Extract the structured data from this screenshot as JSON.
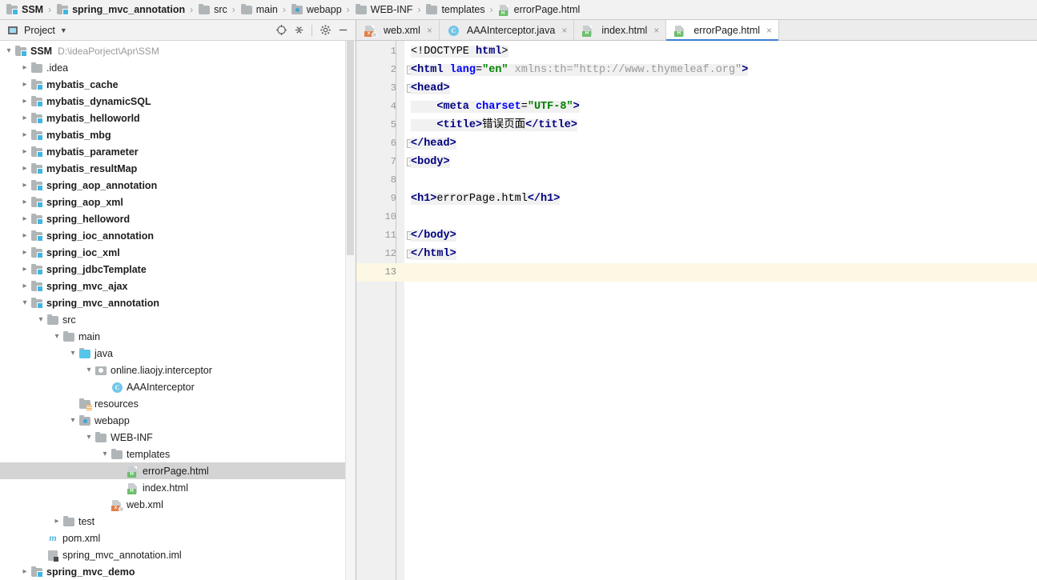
{
  "breadcrumb": {
    "items": [
      {
        "label": "SSM",
        "icon": "module-icon",
        "bold": true
      },
      {
        "label": "spring_mvc_annotation",
        "icon": "module-icon",
        "bold": true
      },
      {
        "label": "src",
        "icon": "folder-icon",
        "bold": false
      },
      {
        "label": "main",
        "icon": "folder-icon",
        "bold": false
      },
      {
        "label": "webapp",
        "icon": "web-folder-icon",
        "bold": false
      },
      {
        "label": "WEB-INF",
        "icon": "folder-icon",
        "bold": false
      },
      {
        "label": "templates",
        "icon": "folder-icon",
        "bold": false
      },
      {
        "label": "errorPage.html",
        "icon": "html-file-icon",
        "bold": false
      }
    ],
    "separator": "›"
  },
  "tool_window": {
    "title": "Project",
    "dropdown_caret": "▼",
    "actions": [
      {
        "name": "select-opened-file-icon",
        "glyph": "⊕"
      },
      {
        "name": "collapse-all-icon",
        "glyph": "⩒"
      },
      {
        "name": "settings-gear-icon",
        "glyph": "⚙"
      },
      {
        "name": "hide-icon",
        "glyph": "—"
      }
    ]
  },
  "tree": {
    "rows": [
      {
        "label": "SSM",
        "hint": "D:\\ideaPorject\\Apr\\SSM",
        "indent": 0,
        "arrow": "expanded",
        "icon": "module-icon",
        "bold": true,
        "selected": false
      },
      {
        "label": ".idea",
        "hint": "",
        "indent": 1,
        "arrow": "collapsed",
        "icon": "folder-icon",
        "bold": false,
        "selected": false
      },
      {
        "label": "mybatis_cache",
        "hint": "",
        "indent": 1,
        "arrow": "collapsed",
        "icon": "module-icon",
        "bold": true,
        "selected": false
      },
      {
        "label": "mybatis_dynamicSQL",
        "hint": "",
        "indent": 1,
        "arrow": "collapsed",
        "icon": "module-icon",
        "bold": true,
        "selected": false
      },
      {
        "label": "mybatis_helloworld",
        "hint": "",
        "indent": 1,
        "arrow": "collapsed",
        "icon": "module-icon",
        "bold": true,
        "selected": false
      },
      {
        "label": "mybatis_mbg",
        "hint": "",
        "indent": 1,
        "arrow": "collapsed",
        "icon": "module-icon",
        "bold": true,
        "selected": false
      },
      {
        "label": "mybatis_parameter",
        "hint": "",
        "indent": 1,
        "arrow": "collapsed",
        "icon": "module-icon",
        "bold": true,
        "selected": false
      },
      {
        "label": "mybatis_resultMap",
        "hint": "",
        "indent": 1,
        "arrow": "collapsed",
        "icon": "module-icon",
        "bold": true,
        "selected": false
      },
      {
        "label": "spring_aop_annotation",
        "hint": "",
        "indent": 1,
        "arrow": "collapsed",
        "icon": "module-icon",
        "bold": true,
        "selected": false
      },
      {
        "label": "spring_aop_xml",
        "hint": "",
        "indent": 1,
        "arrow": "collapsed",
        "icon": "module-icon",
        "bold": true,
        "selected": false
      },
      {
        "label": "spring_helloword",
        "hint": "",
        "indent": 1,
        "arrow": "collapsed",
        "icon": "module-icon",
        "bold": true,
        "selected": false
      },
      {
        "label": "spring_ioc_annotation",
        "hint": "",
        "indent": 1,
        "arrow": "collapsed",
        "icon": "module-icon",
        "bold": true,
        "selected": false
      },
      {
        "label": "spring_ioc_xml",
        "hint": "",
        "indent": 1,
        "arrow": "collapsed",
        "icon": "module-icon",
        "bold": true,
        "selected": false
      },
      {
        "label": "spring_jdbcTemplate",
        "hint": "",
        "indent": 1,
        "arrow": "collapsed",
        "icon": "module-icon",
        "bold": true,
        "selected": false
      },
      {
        "label": "spring_mvc_ajax",
        "hint": "",
        "indent": 1,
        "arrow": "collapsed",
        "icon": "module-icon",
        "bold": true,
        "selected": false
      },
      {
        "label": "spring_mvc_annotation",
        "hint": "",
        "indent": 1,
        "arrow": "expanded",
        "icon": "module-icon",
        "bold": true,
        "selected": false
      },
      {
        "label": "src",
        "hint": "",
        "indent": 2,
        "arrow": "expanded",
        "icon": "folder-icon",
        "bold": false,
        "selected": false
      },
      {
        "label": "main",
        "hint": "",
        "indent": 3,
        "arrow": "expanded",
        "icon": "folder-icon",
        "bold": false,
        "selected": false
      },
      {
        "label": "java",
        "hint": "",
        "indent": 4,
        "arrow": "expanded",
        "icon": "source-folder-icon",
        "bold": false,
        "selected": false
      },
      {
        "label": "online.liaojy.interceptor",
        "hint": "",
        "indent": 5,
        "arrow": "expanded",
        "icon": "package-icon",
        "bold": false,
        "selected": false
      },
      {
        "label": "AAAInterceptor",
        "hint": "",
        "indent": 6,
        "arrow": "none",
        "icon": "java-class-icon",
        "bold": false,
        "selected": false
      },
      {
        "label": "resources",
        "hint": "",
        "indent": 4,
        "arrow": "none",
        "icon": "resources-folder-icon",
        "bold": false,
        "selected": false
      },
      {
        "label": "webapp",
        "hint": "",
        "indent": 4,
        "arrow": "expanded",
        "icon": "web-folder-icon",
        "bold": false,
        "selected": false
      },
      {
        "label": "WEB-INF",
        "hint": "",
        "indent": 5,
        "arrow": "expanded",
        "icon": "folder-icon",
        "bold": false,
        "selected": false
      },
      {
        "label": "templates",
        "hint": "",
        "indent": 6,
        "arrow": "expanded",
        "icon": "folder-icon",
        "bold": false,
        "selected": false
      },
      {
        "label": "errorPage.html",
        "hint": "",
        "indent": 7,
        "arrow": "none",
        "icon": "html-file-icon",
        "bold": false,
        "selected": true
      },
      {
        "label": "index.html",
        "hint": "",
        "indent": 7,
        "arrow": "none",
        "icon": "html-file-icon",
        "bold": false,
        "selected": false
      },
      {
        "label": "web.xml",
        "hint": "",
        "indent": 6,
        "arrow": "none",
        "icon": "web-xml-file-icon",
        "bold": false,
        "selected": false
      },
      {
        "label": "test",
        "hint": "",
        "indent": 3,
        "arrow": "collapsed",
        "icon": "folder-icon",
        "bold": false,
        "selected": false
      },
      {
        "label": "pom.xml",
        "hint": "",
        "indent": 2,
        "arrow": "none",
        "icon": "maven-pom-icon",
        "bold": false,
        "selected": false
      },
      {
        "label": "spring_mvc_annotation.iml",
        "hint": "",
        "indent": 2,
        "arrow": "none",
        "icon": "iml-file-icon",
        "bold": false,
        "selected": false
      },
      {
        "label": "spring_mvc_demo",
        "hint": "",
        "indent": 1,
        "arrow": "collapsed",
        "icon": "module-icon",
        "bold": true,
        "selected": false
      }
    ]
  },
  "editor_tabs": [
    {
      "label": "web.xml",
      "icon": "web-xml-file-icon",
      "active": false,
      "close": "×"
    },
    {
      "label": "AAAInterceptor.java",
      "icon": "java-class-icon",
      "active": false,
      "close": "×"
    },
    {
      "label": "index.html",
      "icon": "html-file-icon",
      "active": false,
      "close": "×"
    },
    {
      "label": "errorPage.html",
      "icon": "html-file-icon",
      "active": true,
      "close": "×"
    }
  ],
  "editor": {
    "current_line": 13,
    "line_numbers": [
      "1",
      "2",
      "3",
      "4",
      "5",
      "6",
      "7",
      "8",
      "9",
      "10",
      "11",
      "12",
      "13"
    ],
    "folds": {
      "2": true,
      "3": true,
      "6": true,
      "7": true,
      "11": true,
      "12": true
    },
    "fold_glyph": "−",
    "code": [
      {
        "n": 1,
        "segments": [
          {
            "t": "<!DOCTYPE ",
            "c": "txt"
          },
          {
            "t": "html",
            "c": "tag"
          },
          {
            "t": ">",
            "c": "txt"
          }
        ]
      },
      {
        "n": 2,
        "segments": [
          {
            "t": "<html ",
            "c": "tag"
          },
          {
            "t": "lang",
            "c": "attr"
          },
          {
            "t": "=",
            "c": "txt"
          },
          {
            "t": "\"en\"",
            "c": "val"
          },
          {
            "t": " xmlns:th=\"http://www.thymeleaf.org\"",
            "c": "dim"
          },
          {
            "t": ">",
            "c": "tag"
          }
        ]
      },
      {
        "n": 3,
        "segments": [
          {
            "t": "<head>",
            "c": "tag"
          }
        ]
      },
      {
        "n": 4,
        "segments": [
          {
            "t": "    ",
            "c": "txt"
          },
          {
            "t": "<meta ",
            "c": "tag"
          },
          {
            "t": "charset",
            "c": "attr"
          },
          {
            "t": "=",
            "c": "txt"
          },
          {
            "t": "\"UTF-8\"",
            "c": "val"
          },
          {
            "t": ">",
            "c": "tag"
          }
        ]
      },
      {
        "n": 5,
        "segments": [
          {
            "t": "    ",
            "c": "txt"
          },
          {
            "t": "<title>",
            "c": "tag"
          },
          {
            "t": "错误页面",
            "c": "txt"
          },
          {
            "t": "</title>",
            "c": "tag"
          }
        ]
      },
      {
        "n": 6,
        "segments": [
          {
            "t": "</head>",
            "c": "tag"
          }
        ]
      },
      {
        "n": 7,
        "segments": [
          {
            "t": "<body>",
            "c": "tag"
          }
        ]
      },
      {
        "n": 8,
        "segments": [
          {
            "t": "",
            "c": "txt"
          }
        ]
      },
      {
        "n": 9,
        "segments": [
          {
            "t": "<h1>",
            "c": "tag"
          },
          {
            "t": "errorPage.html",
            "c": "txt"
          },
          {
            "t": "</h1>",
            "c": "tag"
          }
        ]
      },
      {
        "n": 10,
        "segments": [
          {
            "t": "",
            "c": "txt"
          }
        ]
      },
      {
        "n": 11,
        "segments": [
          {
            "t": "</body>",
            "c": "tag"
          }
        ]
      },
      {
        "n": 12,
        "segments": [
          {
            "t": "</html>",
            "c": "tag"
          }
        ]
      },
      {
        "n": 13,
        "segments": [
          {
            "t": "",
            "c": "txt"
          }
        ]
      }
    ]
  },
  "colors": {
    "accent_blue": "#3b7fd4",
    "tag": "#000080",
    "attribute": "#0000ff",
    "string": "#008000",
    "dimmed": "#9a9a9a",
    "current_line_bg": "#fcf8e4",
    "selection_bg": "#d4d4d4",
    "toolbar_bg": "#f2f2f2"
  }
}
